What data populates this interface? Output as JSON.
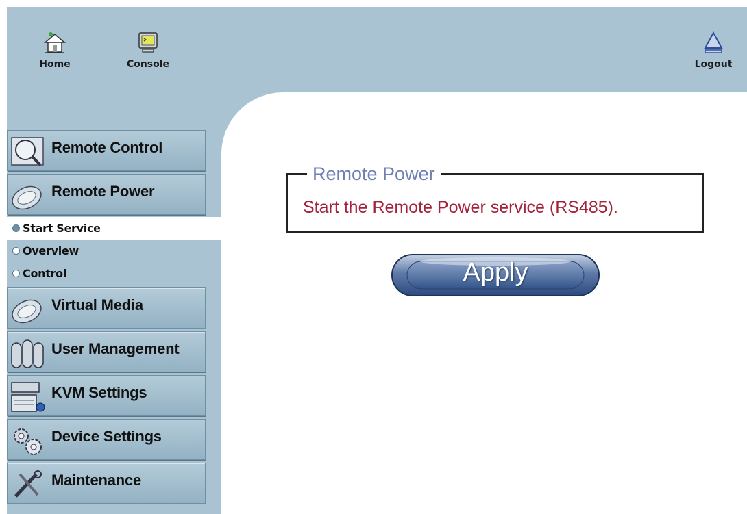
{
  "topbar": {
    "home_label": "Home",
    "console_label": "Console",
    "logout_label": "Logout"
  },
  "sidebar": {
    "items": [
      {
        "label": "Remote Control",
        "icon": "magnifier-screen-icon"
      },
      {
        "label": "Remote Power",
        "icon": "disk-icon"
      },
      {
        "label": "Virtual Media",
        "icon": "disk-icon"
      },
      {
        "label": "User Management",
        "icon": "users-icon"
      },
      {
        "label": "KVM Settings",
        "icon": "keyboard-monitor-icon"
      },
      {
        "label": "Device Settings",
        "icon": "gears-icon"
      },
      {
        "label": "Maintenance",
        "icon": "tools-icon"
      }
    ],
    "submenu": [
      {
        "label": "Start Service",
        "active": true
      },
      {
        "label": "Overview",
        "active": false
      },
      {
        "label": "Control",
        "active": false
      }
    ]
  },
  "main": {
    "section_title": "Remote Power",
    "message": "Start the Remote Power service (RS485).",
    "apply_label": "Apply"
  },
  "colors": {
    "frame": "#a9c3d2",
    "legend": "#6f7fb3",
    "message": "#a2233a"
  }
}
